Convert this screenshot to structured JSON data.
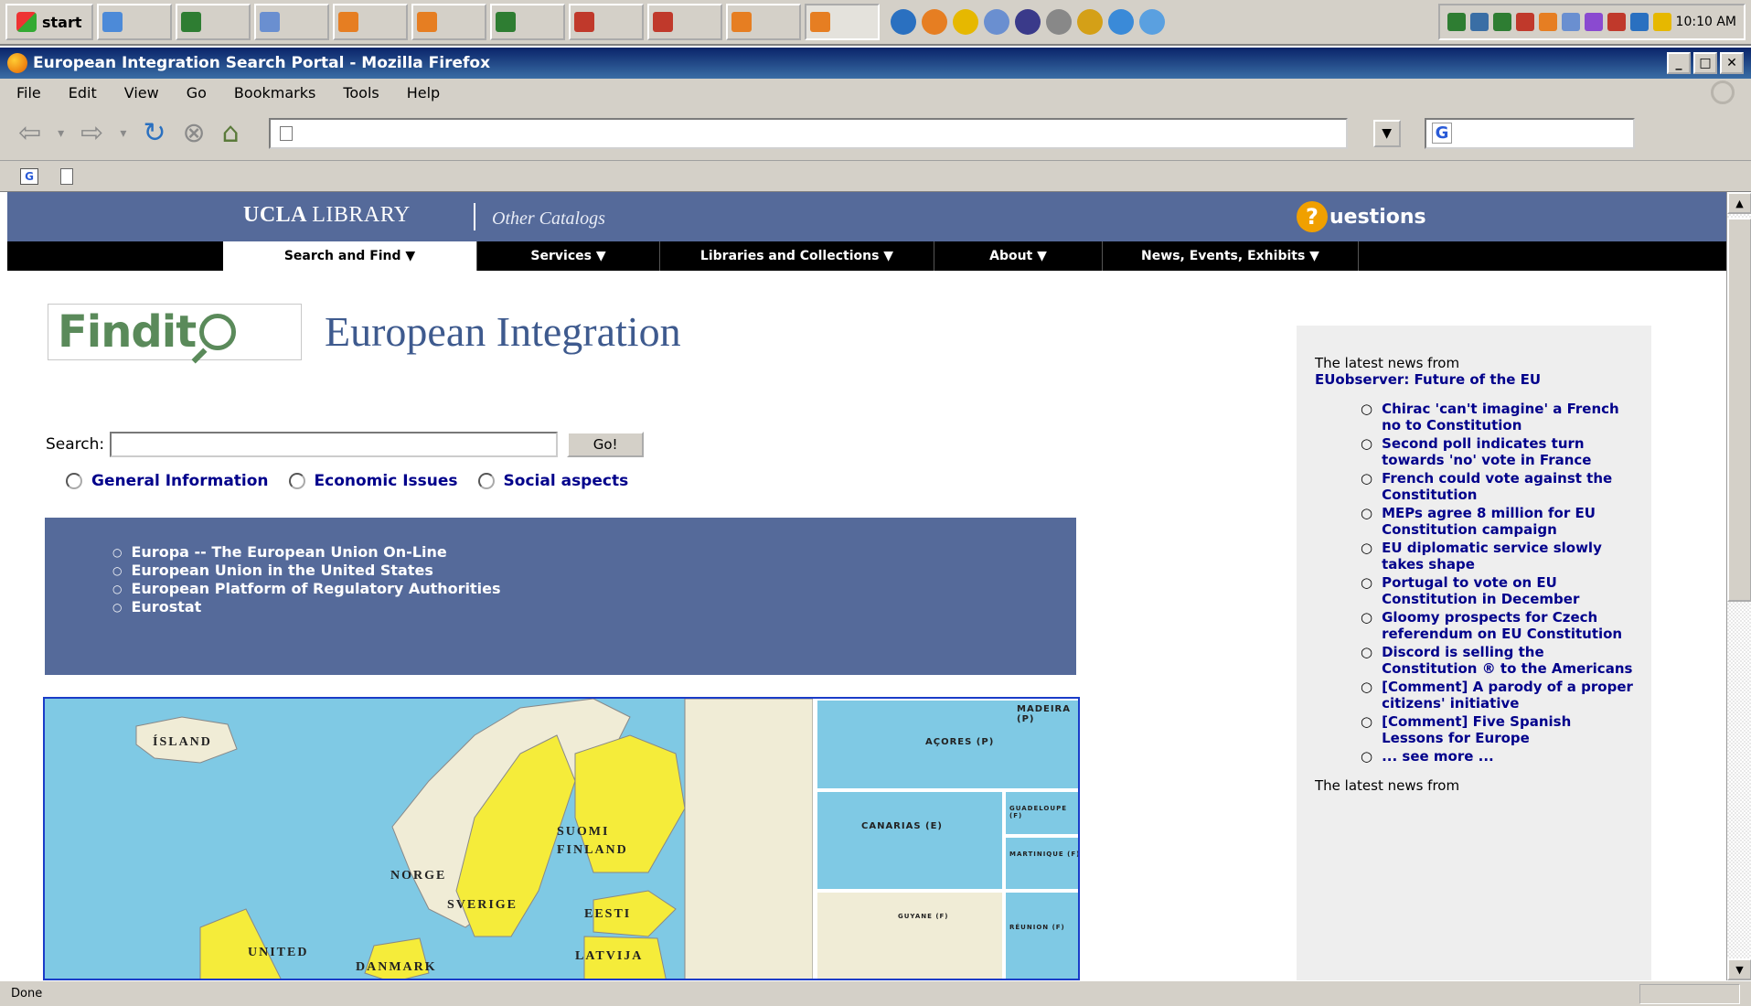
{
  "taskbar": {
    "start_label": "start",
    "tasks": [
      {
        "label": "",
        "color": "#4c8ad8"
      },
      {
        "label": "",
        "color": "#2e7d32"
      },
      {
        "label": "",
        "color": "#6a8fd0"
      },
      {
        "label": "",
        "color": "#e67e22"
      },
      {
        "label": "",
        "color": "#e67e22"
      },
      {
        "label": "",
        "color": "#2e7d32"
      },
      {
        "label": "",
        "color": "#c0392b"
      },
      {
        "label": "",
        "color": "#c0392b"
      },
      {
        "label": "",
        "color": "#e67e22"
      },
      {
        "label": "",
        "color": "#e67e22"
      }
    ],
    "clock": "10:10 AM"
  },
  "window": {
    "title": "European Integration Search Portal - Mozilla Firefox",
    "menu": [
      "File",
      "Edit",
      "View",
      "Go",
      "Bookmarks",
      "Tools",
      "Help"
    ]
  },
  "navigation": {
    "url": "",
    "search_engine_icon": "G"
  },
  "bookmarks_bar": {
    "items": [
      "",
      ""
    ]
  },
  "page": {
    "header": {
      "logo_bold": "UCLA",
      "logo_rest": "LIBRARY",
      "other_catalogs": "Other Catalogs",
      "questions_label": "uestions",
      "questions_icon_glyph": "?"
    },
    "nav": [
      {
        "label": "Search and Find ▼",
        "active": true
      },
      {
        "label": "Services ▼",
        "active": false
      },
      {
        "label": "Libraries and Collections ▼",
        "active": false
      },
      {
        "label": "About ▼",
        "active": false
      },
      {
        "label": "News, Events, Exhibits ▼",
        "active": false
      }
    ],
    "findit_word": "Findit",
    "title": "European Integration",
    "intro": "",
    "search": {
      "label": "Search:",
      "value": "",
      "go_label": "Go!"
    },
    "limit": {
      "prefix": "",
      "options": [
        "General Information",
        "Economic Issues",
        "Social aspects"
      ]
    },
    "highlighted": {
      "title": "",
      "sites": [
        "Europa -- The European Union On-Line",
        "European Union in the United States",
        "European Platform of Regulatory Authorities",
        "Eurostat"
      ]
    },
    "map": {
      "labels": [
        "ÍSLAND",
        "NORGE",
        "SVERIGE",
        "SUOMI FINLAND",
        "EESTI",
        "LATVIJA",
        "DANMARK",
        "UNITED"
      ],
      "inset_labels": [
        "AÇORES (P)",
        "CANARIAS (E)",
        "MADEIRA (P)",
        "GUADELOUPE (F)",
        "MARTINIQUE (F)",
        "RÉUNION (F)",
        "GUYANE (F)"
      ]
    },
    "sidebar": {
      "intro": "The latest news from",
      "source": "EUobserver: Future of the EU",
      "news": [
        "Chirac 'can't imagine' a French no to Constitution",
        "Second poll indicates turn towards 'no' vote in France",
        "French could vote against the Constitution",
        "MEPs agree 8 million for EU Constitution campaign",
        "EU diplomatic service slowly takes shape",
        "Portugal to vote on EU Constitution in December",
        "Gloomy prospects for Czech referendum on EU Constitution",
        "Discord is selling the Constitution ® to the Americans",
        "[Comment] A parody of a proper citizens' initiative",
        "[Comment] Five Spanish Lessons for Europe",
        "... see more ..."
      ],
      "intro2": "The latest news from"
    }
  },
  "status": {
    "text": "Done"
  },
  "colors": {
    "ucla_blue": "#556a9a",
    "link": "#00008b",
    "findit_green": "#5a8a5a",
    "title_blue": "#3e5a8e"
  }
}
